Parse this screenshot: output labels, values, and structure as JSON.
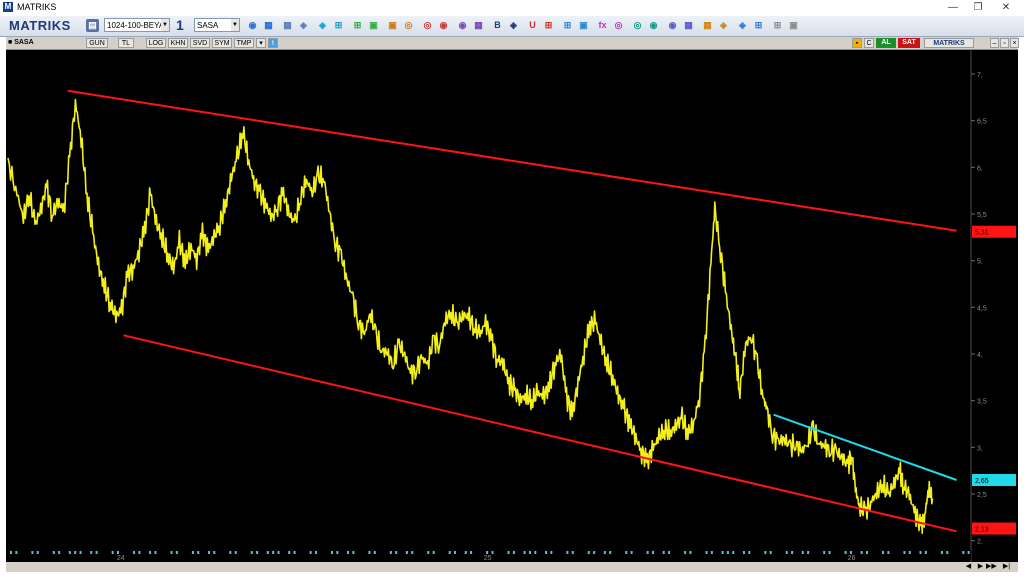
{
  "window": {
    "title": "MATRIKS",
    "logo_letter": "M",
    "minimize": "—",
    "maximize": "❐",
    "close": "✕"
  },
  "toolbar": {
    "brand": "MATRIKS",
    "template_value": "1024-100-BEYA",
    "chart_count": "1",
    "symbol_value": "SASA",
    "icons": [
      "save-icon",
      "drawing-icon",
      "zoom-icon",
      "line-tool-icon",
      "bar-chart-icon",
      "pie-icon",
      "indicator-icon",
      "bold-icon",
      "undo-icon",
      "font-icon",
      "fx-icon",
      "calendar-icon",
      "grid-icon",
      "alarm-icon",
      "print-icon",
      "settings-icon"
    ],
    "icon_glyphs": {
      "bold": "B",
      "undo": "U",
      "fx": "fx"
    }
  },
  "subbar": {
    "symbol": "SASA",
    "buttons": [
      "GUN",
      "TL",
      "LOG",
      "KHN",
      "SVD",
      "SYM",
      "TMP"
    ],
    "buy": "AL",
    "sell": "SAT",
    "c": "C",
    "brand": "MATRIKS"
  },
  "chart_data": {
    "type": "line",
    "symbol": "SASA",
    "ylim": [
      1.9,
      7.15
    ],
    "y_ticks": [
      2,
      2.5,
      3,
      3.5,
      4,
      4.5,
      5,
      5.5,
      6,
      6.5,
      7
    ],
    "y_tick_labels": [
      "2,",
      "2,5",
      "3,",
      "3,5",
      "4,",
      "4,5",
      "5,",
      "5,5",
      "6,",
      "6,5",
      "7,"
    ],
    "x_tick_labels": [
      {
        "label": "24",
        "t": 0.113
      },
      {
        "label": "25",
        "t": 0.494
      },
      {
        "label": "26",
        "t": 0.872
      }
    ],
    "series": [
      {
        "color": "#f2ef1a",
        "values": [
          [
            0.0,
            6.05
          ],
          [
            0.008,
            5.78
          ],
          [
            0.016,
            5.45
          ],
          [
            0.022,
            5.72
          ],
          [
            0.028,
            5.38
          ],
          [
            0.034,
            5.55
          ],
          [
            0.04,
            5.8
          ],
          [
            0.046,
            5.5
          ],
          [
            0.052,
            5.62
          ],
          [
            0.058,
            5.55
          ],
          [
            0.064,
            6.1
          ],
          [
            0.07,
            6.7
          ],
          [
            0.076,
            6.3
          ],
          [
            0.082,
            5.7
          ],
          [
            0.088,
            5.3
          ],
          [
            0.094,
            4.95
          ],
          [
            0.1,
            4.72
          ],
          [
            0.106,
            4.55
          ],
          [
            0.112,
            4.4
          ],
          [
            0.118,
            4.48
          ],
          [
            0.124,
            4.85
          ],
          [
            0.13,
            4.92
          ],
          [
            0.136,
            5.1
          ],
          [
            0.142,
            5.35
          ],
          [
            0.148,
            5.72
          ],
          [
            0.154,
            5.4
          ],
          [
            0.16,
            5.25
          ],
          [
            0.166,
            5.05
          ],
          [
            0.172,
            4.92
          ],
          [
            0.178,
            5.2
          ],
          [
            0.184,
            4.98
          ],
          [
            0.19,
            5.15
          ],
          [
            0.196,
            5.02
          ],
          [
            0.202,
            5.3
          ],
          [
            0.208,
            5.12
          ],
          [
            0.214,
            5.25
          ],
          [
            0.22,
            5.4
          ],
          [
            0.226,
            5.6
          ],
          [
            0.232,
            5.9
          ],
          [
            0.238,
            6.1
          ],
          [
            0.244,
            6.4
          ],
          [
            0.25,
            6.05
          ],
          [
            0.256,
            5.85
          ],
          [
            0.262,
            5.7
          ],
          [
            0.268,
            5.6
          ],
          [
            0.274,
            5.45
          ],
          [
            0.28,
            5.6
          ],
          [
            0.286,
            5.72
          ],
          [
            0.292,
            5.5
          ],
          [
            0.298,
            5.4
          ],
          [
            0.304,
            5.7
          ],
          [
            0.31,
            5.85
          ],
          [
            0.316,
            5.75
          ],
          [
            0.322,
            5.9
          ],
          [
            0.328,
            5.88
          ],
          [
            0.334,
            5.5
          ],
          [
            0.34,
            5.2
          ],
          [
            0.346,
            5.05
          ],
          [
            0.352,
            4.8
          ],
          [
            0.358,
            4.6
          ],
          [
            0.364,
            4.35
          ],
          [
            0.37,
            4.2
          ],
          [
            0.376,
            4.45
          ],
          [
            0.382,
            4.2
          ],
          [
            0.388,
            4.05
          ],
          [
            0.394,
            4.0
          ],
          [
            0.4,
            3.9
          ],
          [
            0.406,
            4.1
          ],
          [
            0.412,
            4.0
          ],
          [
            0.418,
            3.78
          ],
          [
            0.424,
            3.85
          ],
          [
            0.43,
            3.95
          ],
          [
            0.436,
            3.9
          ],
          [
            0.442,
            4.15
          ],
          [
            0.448,
            4.1
          ],
          [
            0.454,
            4.35
          ],
          [
            0.46,
            4.45
          ],
          [
            0.466,
            4.3
          ],
          [
            0.472,
            4.42
          ],
          [
            0.478,
            4.4
          ],
          [
            0.484,
            4.3
          ],
          [
            0.49,
            4.2
          ],
          [
            0.496,
            4.35
          ],
          [
            0.502,
            4.15
          ],
          [
            0.508,
            3.95
          ],
          [
            0.514,
            3.9
          ],
          [
            0.52,
            3.7
          ],
          [
            0.526,
            3.6
          ],
          [
            0.532,
            3.52
          ],
          [
            0.538,
            3.55
          ],
          [
            0.544,
            3.5
          ],
          [
            0.55,
            3.58
          ],
          [
            0.556,
            3.55
          ],
          [
            0.562,
            3.65
          ],
          [
            0.568,
            3.9
          ],
          [
            0.574,
            4.0
          ],
          [
            0.58,
            3.55
          ],
          [
            0.586,
            3.35
          ],
          [
            0.592,
            3.7
          ],
          [
            0.598,
            4.0
          ],
          [
            0.604,
            4.3
          ],
          [
            0.61,
            4.35
          ],
          [
            0.616,
            4.1
          ],
          [
            0.622,
            3.9
          ],
          [
            0.628,
            3.75
          ],
          [
            0.634,
            3.55
          ],
          [
            0.64,
            3.4
          ],
          [
            0.646,
            3.25
          ],
          [
            0.652,
            3.1
          ],
          [
            0.658,
            2.95
          ],
          [
            0.664,
            2.85
          ],
          [
            0.67,
            3.0
          ],
          [
            0.676,
            3.1
          ],
          [
            0.682,
            3.2
          ],
          [
            0.688,
            3.15
          ],
          [
            0.694,
            3.25
          ],
          [
            0.7,
            3.3
          ],
          [
            0.706,
            3.15
          ],
          [
            0.712,
            3.25
          ],
          [
            0.718,
            3.55
          ],
          [
            0.724,
            4.1
          ],
          [
            0.73,
            5.0
          ],
          [
            0.734,
            5.55
          ],
          [
            0.74,
            5.1
          ],
          [
            0.746,
            4.6
          ],
          [
            0.752,
            4.2
          ],
          [
            0.756,
            3.9
          ],
          [
            0.76,
            3.6
          ],
          [
            0.766,
            4.1
          ],
          [
            0.772,
            4.2
          ],
          [
            0.778,
            3.9
          ],
          [
            0.784,
            3.55
          ],
          [
            0.788,
            3.4
          ],
          [
            0.794,
            3.15
          ],
          [
            0.8,
            3.05
          ],
          [
            0.806,
            3.1
          ],
          [
            0.812,
            3.0
          ],
          [
            0.818,
            3.05
          ],
          [
            0.824,
            2.95
          ],
          [
            0.83,
            3.05
          ],
          [
            0.836,
            3.2
          ],
          [
            0.842,
            3.05
          ],
          [
            0.848,
            3.0
          ],
          [
            0.854,
            2.98
          ],
          [
            0.86,
            2.95
          ],
          [
            0.866,
            2.9
          ],
          [
            0.872,
            2.8
          ],
          [
            0.876,
            2.95
          ],
          [
            0.88,
            2.55
          ],
          [
            0.884,
            2.38
          ],
          [
            0.89,
            2.3
          ],
          [
            0.896,
            2.42
          ],
          [
            0.902,
            2.5
          ],
          [
            0.908,
            2.62
          ],
          [
            0.914,
            2.48
          ],
          [
            0.92,
            2.62
          ],
          [
            0.926,
            2.75
          ],
          [
            0.93,
            2.6
          ],
          [
            0.936,
            2.48
          ],
          [
            0.942,
            2.3
          ],
          [
            0.948,
            2.15
          ],
          [
            0.952,
            2.28
          ],
          [
            0.956,
            2.55
          ],
          [
            0.96,
            2.45
          ]
        ]
      }
    ],
    "trendlines": [
      {
        "name": "upper-resistance",
        "color": "#ff1414",
        "from": [
          0.062,
          6.82
        ],
        "to": [
          0.985,
          5.32
        ]
      },
      {
        "name": "lower-support",
        "color": "#ff1414",
        "from": [
          0.12,
          4.2
        ],
        "to": [
          0.985,
          2.1
        ]
      },
      {
        "name": "short-resistance",
        "color": "#22d9e8",
        "from": [
          0.795,
          3.35
        ],
        "to": [
          0.985,
          2.65
        ]
      }
    ],
    "price_labels": [
      {
        "text": "5,31",
        "value": 5.31,
        "color": "#ff1414"
      },
      {
        "text": "2,65",
        "value": 2.65,
        "color": "#22d9e8"
      },
      {
        "text": "2,13",
        "value": 2.13,
        "color": "#ff1414"
      }
    ]
  }
}
